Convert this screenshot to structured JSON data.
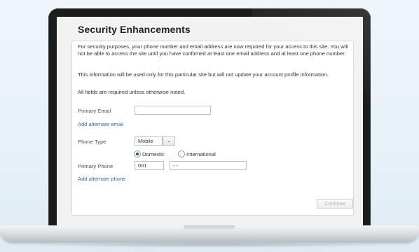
{
  "form": {
    "title": "Security Enhancements",
    "intro": "For security purposes, your phone number and email address are now required for your access to this site. You will not be able to access the site until you have confirmed at least one email address and at least one phone number.",
    "info": "This information will be used only for this particular site but will not update your account profile information.",
    "required_note": "All fields are required unless otherwise noted.",
    "primary_email_label": "Primary Email",
    "primary_email_value": "",
    "add_alternate_email": "Add alternate email",
    "phone_type_label": "Phone Type",
    "phone_type_selected": "Mobile",
    "radio_domestic": "Domestic",
    "radio_international": "International",
    "primary_phone_label": "Primary Phone",
    "country_code_value": "001",
    "phone_number_value": "- -",
    "add_alternate_phone": "Add alternate phone",
    "continue_label": "Continue"
  },
  "colors": {
    "link": "#2a6fb0",
    "bezel": "#1b1c1e"
  }
}
